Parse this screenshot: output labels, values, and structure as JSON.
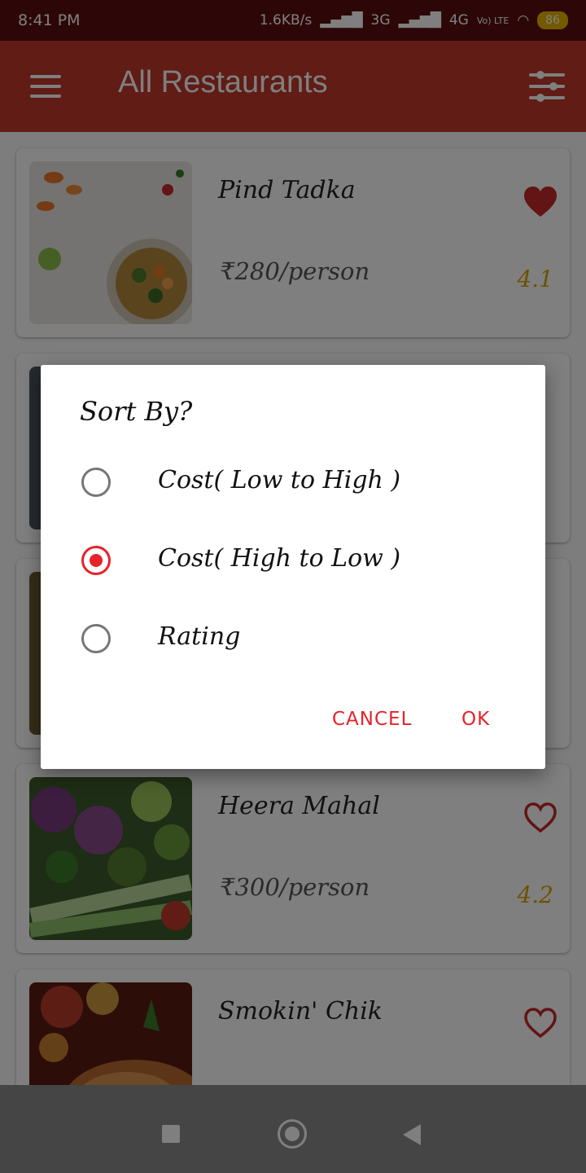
{
  "status_bar": {
    "time": "8:41 PM",
    "network_speed": "1.6KB/s",
    "network_3g": "3G",
    "network_4g": "4G",
    "volte": "Vo) LTE",
    "battery": "86"
  },
  "app_bar": {
    "title": "All Restaurants",
    "menu_icon": "hamburger-menu-icon",
    "filter_icon": "sliders-filter-icon"
  },
  "restaurants": [
    {
      "name": "Pind Tadka",
      "price": "₹280/person",
      "rating": "4.1",
      "favorite": true
    },
    {
      "name": "Heera Mahal",
      "price": "₹300/person",
      "rating": "4.2",
      "favorite": false
    },
    {
      "name": "Smokin' Chik",
      "price": "",
      "rating": "",
      "favorite": false
    }
  ],
  "dialog": {
    "title": "Sort By?",
    "options": [
      {
        "label": "Cost( Low to High )",
        "checked": false
      },
      {
        "label": "Cost( High to Low )",
        "checked": true
      },
      {
        "label": "Rating",
        "checked": false
      }
    ],
    "cancel_label": "CANCEL",
    "ok_label": "OK"
  },
  "colors": {
    "accent": "#e5232a",
    "app_bar": "#c0392b",
    "status_bar": "#5a0f0f",
    "rating": "#d9a300"
  }
}
